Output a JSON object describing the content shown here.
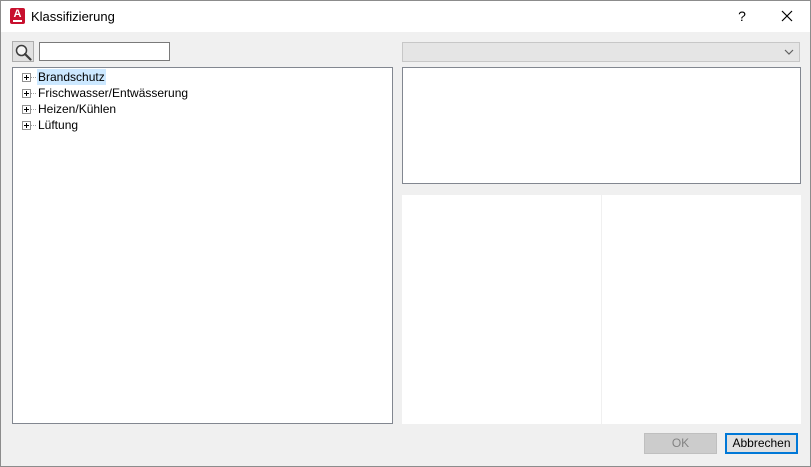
{
  "window": {
    "title": "Klassifizierung",
    "help_label": "?",
    "app_icon_letter": "A"
  },
  "search": {
    "value": "",
    "placeholder": ""
  },
  "tree": {
    "items": [
      {
        "label": "Brandschutz",
        "selected": true,
        "expandable": true
      },
      {
        "label": "Frischwasser/Entwässerung",
        "selected": false,
        "expandable": true
      },
      {
        "label": "Heizen/Kühlen",
        "selected": false,
        "expandable": true
      },
      {
        "label": "Lüftung",
        "selected": false,
        "expandable": true
      }
    ]
  },
  "dropdown": {
    "selected_value": "",
    "disabled": true
  },
  "buttons": {
    "ok_label": "OK",
    "ok_disabled": true,
    "cancel_label": "Abbrechen"
  },
  "colors": {
    "accent": "#0078d7",
    "selection": "#cce8ff",
    "app_icon": "#c8102e"
  },
  "icons": {
    "app": "autocad-app-icon",
    "search": "magnifier-icon",
    "close": "close-x-icon",
    "dropdown": "chevron-down-icon",
    "expander": "plus-box-icon"
  }
}
